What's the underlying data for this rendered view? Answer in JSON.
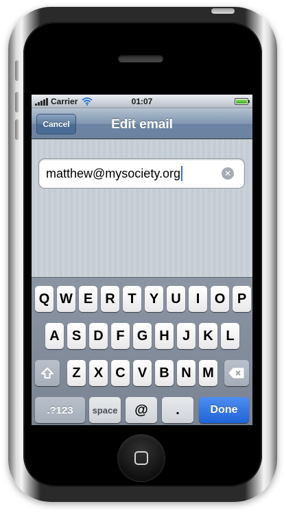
{
  "status_bar": {
    "carrier": "Carrier",
    "time": "01:07"
  },
  "nav": {
    "title": "Edit email",
    "cancel_label": "Cancel"
  },
  "email_field": {
    "value": "matthew@mysociety.org"
  },
  "keyboard": {
    "row1": [
      "Q",
      "W",
      "E",
      "R",
      "T",
      "Y",
      "U",
      "I",
      "O",
      "P"
    ],
    "row2": [
      "A",
      "S",
      "D",
      "F",
      "G",
      "H",
      "J",
      "K",
      "L"
    ],
    "row3": [
      "Z",
      "X",
      "C",
      "V",
      "B",
      "N",
      "M"
    ],
    "numbers_label": ".?123",
    "space_label": "space",
    "at_label": "@",
    "dot_label": ".",
    "done_label": "Done"
  },
  "icons": {
    "signal": "signal-bars-icon",
    "wifi": "wifi-icon",
    "battery": "battery-icon",
    "clear": "clear-icon",
    "shift": "shift-icon",
    "backspace": "backspace-icon"
  },
  "colors": {
    "nav_bar": "#6d85a2",
    "done_key": "#1f63d8",
    "keyboard_bg": "#8c95a3",
    "battery": "#3fa81f"
  }
}
